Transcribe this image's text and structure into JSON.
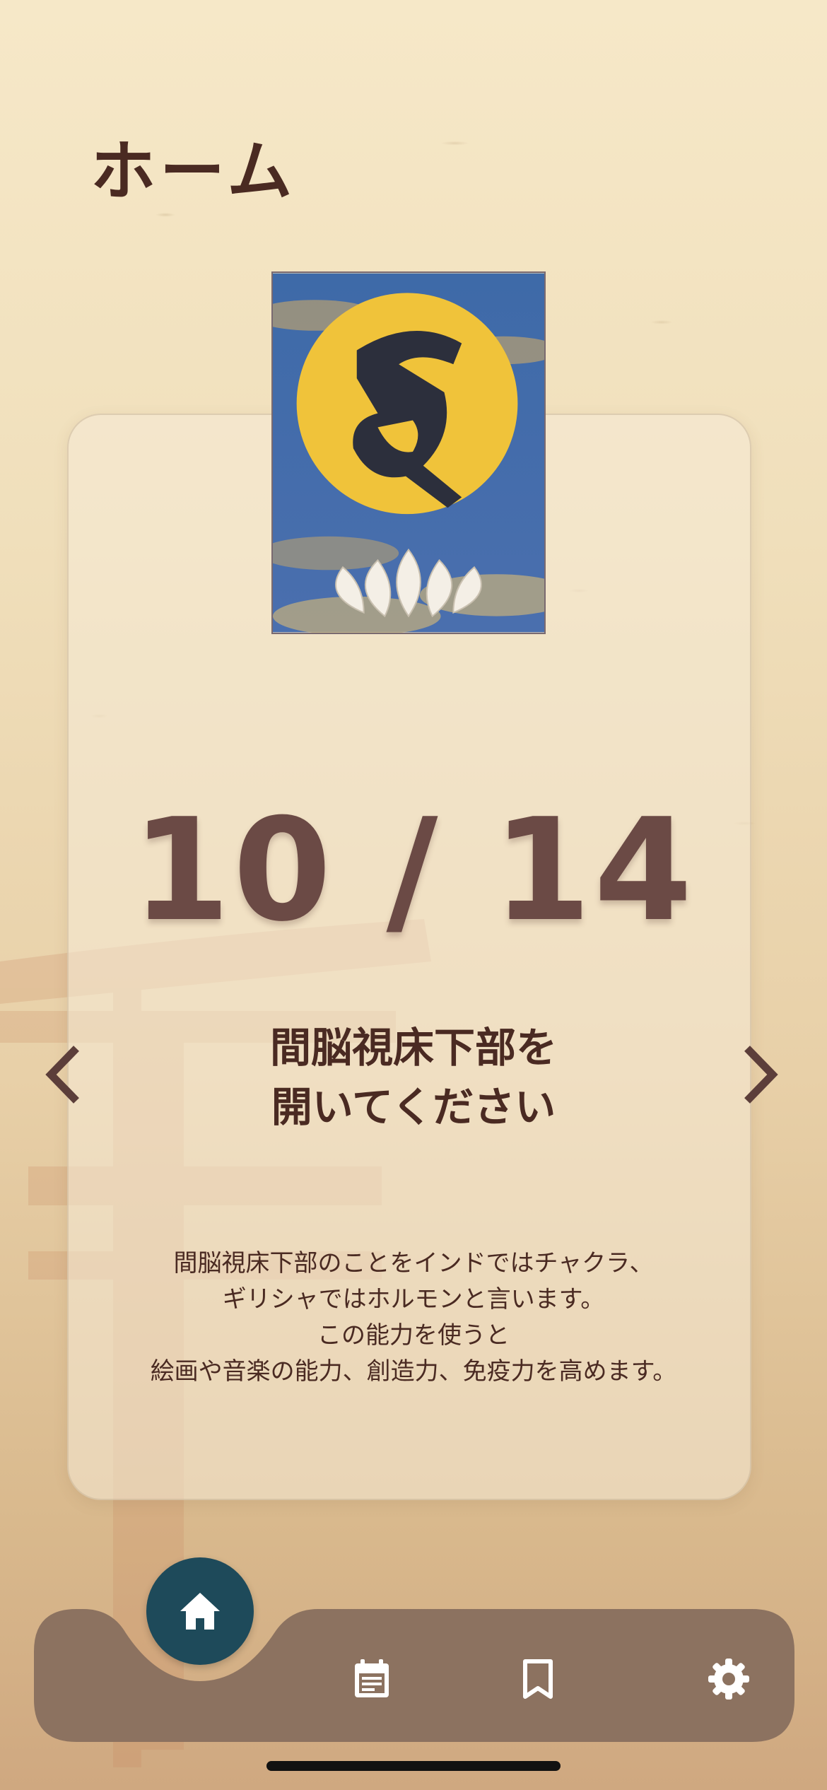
{
  "header": {
    "title": "ホーム"
  },
  "card": {
    "date": "10 / 14",
    "headline_lines": [
      "間脳視床下部を",
      "開いてください"
    ],
    "description_lines": [
      "間脳視床下部のことをインドではチャクラ、",
      "ギリシャではホルモンと言います。",
      "この能力を使うと",
      "絵画や音楽の能力、創造力、免疫力を高めます。"
    ],
    "image": {
      "icon": "sanskrit-seed-syllable-on-moon-and-lotus"
    }
  },
  "navigation": {
    "prev_icon": "chevron-left-icon",
    "next_icon": "chevron-right-icon"
  },
  "bottom_nav": {
    "items": [
      {
        "icon": "home-icon",
        "active": true
      },
      {
        "icon": "calendar-icon",
        "active": false
      },
      {
        "icon": "bookmark-icon",
        "active": false
      },
      {
        "icon": "gear-icon",
        "active": false
      }
    ],
    "colors": {
      "bar": "#8c7260",
      "fab": "#1e4a5a"
    }
  }
}
